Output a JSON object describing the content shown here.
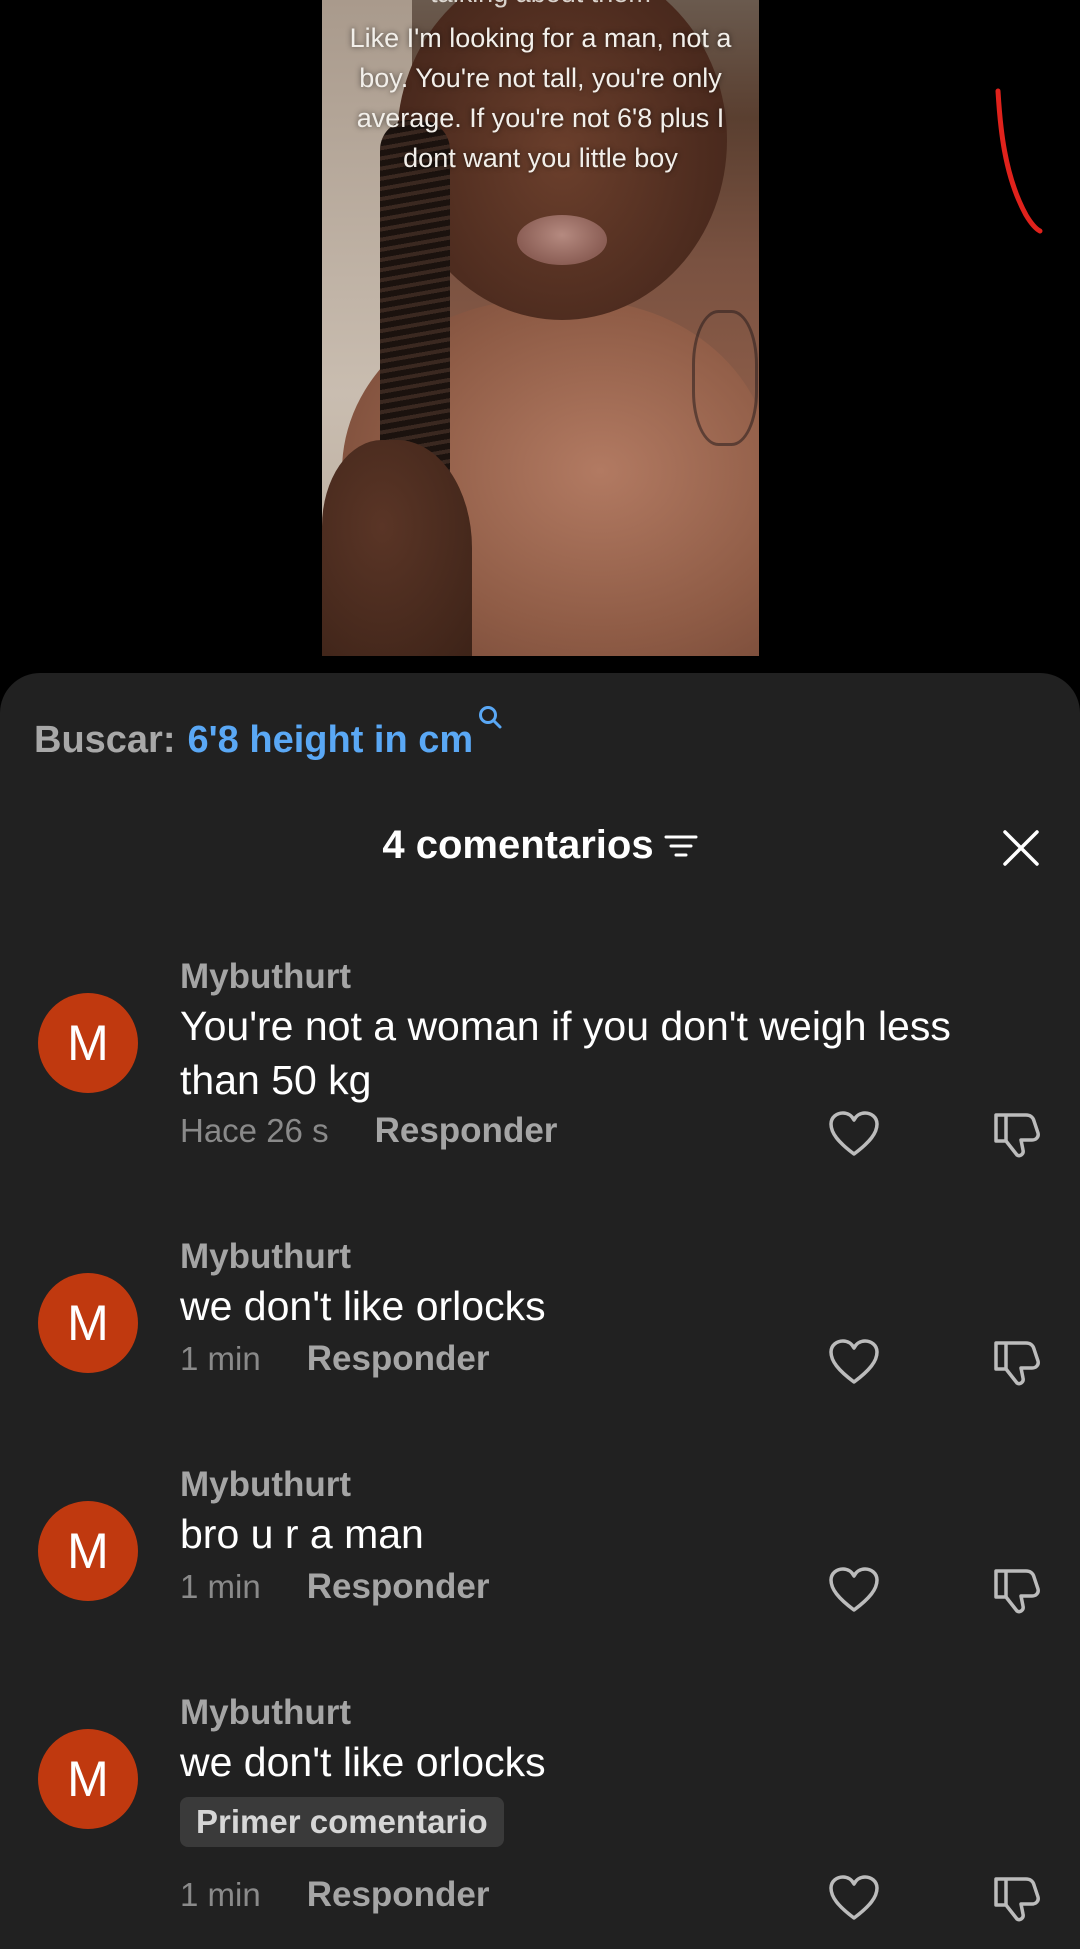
{
  "video": {
    "caption_top": "talking about them",
    "caption": "Like I'm looking for a man, not a boy. You're not tall, you're only average. If you're not 6'8 plus I dont want you little boy"
  },
  "search": {
    "label": "Buscar:",
    "query": "6'8 height in cm"
  },
  "header": {
    "title": "4 comentarios"
  },
  "comments": [
    {
      "avatar": "M",
      "user": "Mybuthurt",
      "text": "You're not a woman if you don't weigh less than 50 kg",
      "time": "Hace 26 s",
      "reply": "Responder"
    },
    {
      "avatar": "M",
      "user": "Mybuthurt",
      "text": "we don't like orlocks",
      "time": "1 min",
      "reply": "Responder"
    },
    {
      "avatar": "M",
      "user": "Mybuthurt",
      "text": "bro u r a man",
      "time": "1 min",
      "reply": "Responder"
    },
    {
      "avatar": "M",
      "user": "Mybuthurt",
      "text": "we don't like orlocks",
      "badge": "Primer comentario",
      "time": "1 min",
      "reply": "Responder"
    }
  ],
  "colors": {
    "sheet_bg": "#212121",
    "avatar_bg": "#c0390f",
    "search_query": "#5aa8f5"
  },
  "icons": [
    "search-icon",
    "filter-icon",
    "close-icon",
    "heart-icon",
    "dislike-icon"
  ]
}
